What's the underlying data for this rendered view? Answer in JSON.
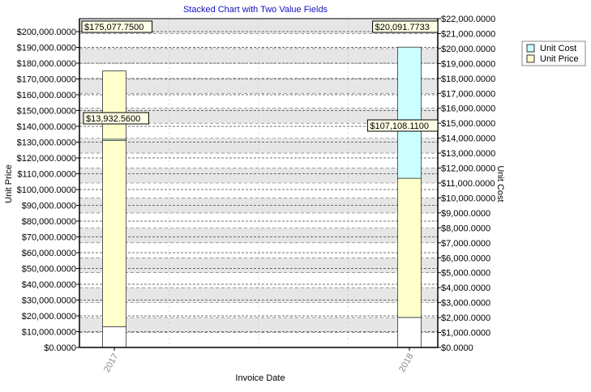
{
  "chart_data": {
    "type": "bar",
    "stacked": true,
    "title": "Stacked Chart with Two Value Fields",
    "xlabel": "Invoice Date",
    "ylabel_left": "Unit Price",
    "ylabel_right": "Unit Cost",
    "categories": [
      "2017",
      "2018"
    ],
    "series": [
      {
        "name": "Unit Price",
        "axis": "left",
        "values": [
          175077.75,
          107108.11
        ],
        "labels": [
          "$175,077.7500",
          "$107,108.1100"
        ],
        "color": "#ffffcc"
      },
      {
        "name": "Unit Cost",
        "axis": "right",
        "values": [
          13932.56,
          20091.7733
        ],
        "labels": [
          "$13,932.5600",
          "$20,091.7733"
        ],
        "color": "#ccffff"
      }
    ],
    "ylim_left": [
      0,
      200000000
    ],
    "ylim_right": [
      0,
      22000000
    ],
    "left_ticks": [
      "$0.0000",
      "$10,000.0000",
      "$20,000.0000",
      "$30,000.0000",
      "$40,000.0000",
      "$50,000.0000",
      "$60,000.0000",
      "$70,000.0000",
      "$80,000.0000",
      "$90,000.0000",
      "$100,000.0000",
      "$110,000.0000",
      "$120,000.0000",
      "$130,000.0000",
      "$140,000.0000",
      "$150,000.0000",
      "$160,000.0000",
      "$170,000.0000",
      "$180,000.0000",
      "$190,000.0000",
      "$200,000.0000"
    ],
    "right_ticks": [
      "$0.0000",
      "$1,000.0000",
      "$2,000.0000",
      "$3,000.0000",
      "$4,000.0000",
      "$5,000.0000",
      "$6,000.0000",
      "$7,000.0000",
      "$8,000.0000",
      "$9,000.0000",
      "$10,000.0000",
      "$11,000.0000",
      "$12,000.0000",
      "$13,000.0000",
      "$14,000.0000",
      "$15,000.0000",
      "$16,000.0000",
      "$17,000.0000",
      "$18,000.0000",
      "$19,000.0000",
      "$20,000.0000",
      "$21,000.0000",
      "$22,000.0000"
    ],
    "legend": {
      "position": "right",
      "entries": [
        "Unit Cost",
        "Unit Price"
      ]
    },
    "grid": true
  },
  "colors": {
    "title": "#1010c0",
    "band_a": "#e6e6e6",
    "band_b": "#ffffff",
    "unit_price_fill": "#ffffcc",
    "unit_cost_fill": "#ccffff",
    "base_fill": "#ffffff"
  }
}
